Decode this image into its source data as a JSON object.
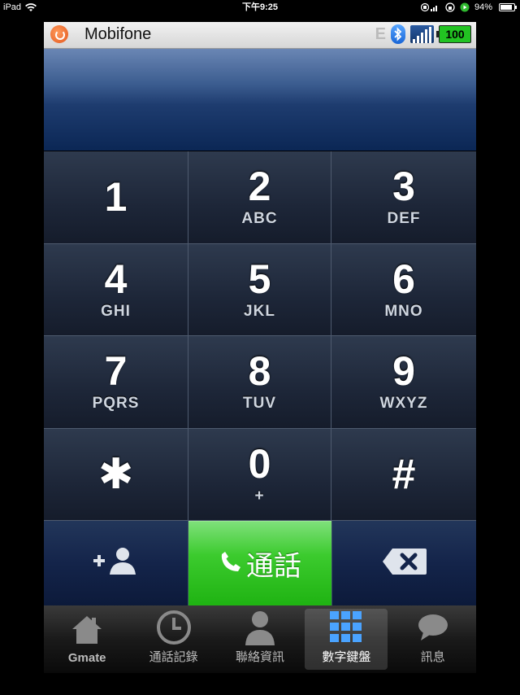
{
  "ipad_status": {
    "device": "iPad",
    "time": "下午9:25",
    "battery": "94%"
  },
  "app_status": {
    "carrier": "Mobifone",
    "network_type": "E",
    "battery_level": "100"
  },
  "keypad": {
    "keys": [
      {
        "digit": "1",
        "letters": ""
      },
      {
        "digit": "2",
        "letters": "ABC"
      },
      {
        "digit": "3",
        "letters": "DEF"
      },
      {
        "digit": "4",
        "letters": "GHI"
      },
      {
        "digit": "5",
        "letters": "JKL"
      },
      {
        "digit": "6",
        "letters": "MNO"
      },
      {
        "digit": "7",
        "letters": "PQRS"
      },
      {
        "digit": "8",
        "letters": "TUV"
      },
      {
        "digit": "9",
        "letters": "WXYZ"
      },
      {
        "digit": "✱",
        "letters": ""
      },
      {
        "digit": "0",
        "letters": "+"
      },
      {
        "digit": "#",
        "letters": ""
      }
    ]
  },
  "actions": {
    "call_label": "通話"
  },
  "tabs": [
    {
      "label": "Gmate",
      "icon": "home-icon"
    },
    {
      "label": "通話記錄",
      "icon": "clock-icon"
    },
    {
      "label": "聯絡資訊",
      "icon": "contact-icon"
    },
    {
      "label": "數字鍵盤",
      "icon": "keypad-icon"
    },
    {
      "label": "訊息",
      "icon": "message-icon"
    }
  ],
  "colors": {
    "call_green": "#3ccb2e",
    "display_blue": "#1e3c6f",
    "key_dark": "#1d2638"
  }
}
